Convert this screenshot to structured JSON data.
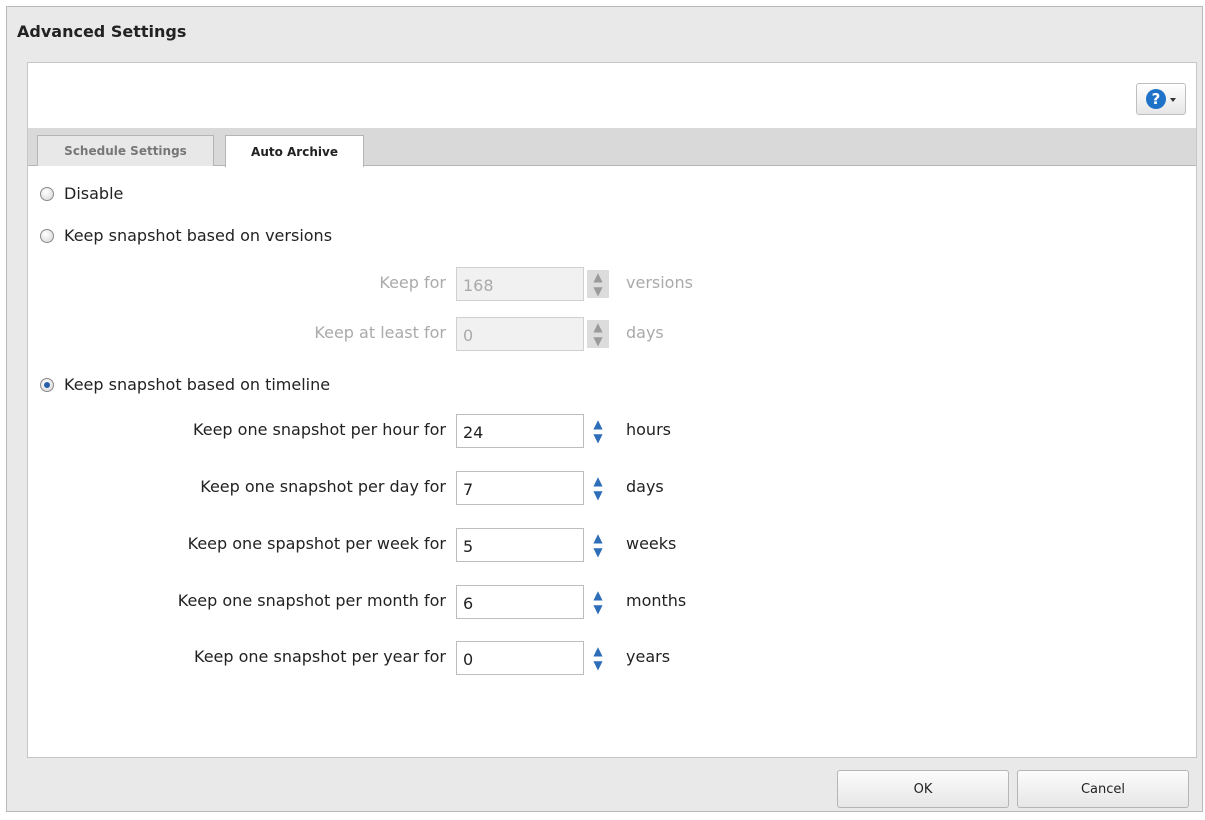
{
  "dialog": {
    "title": "Advanced Settings"
  },
  "help": {
    "icon": "help-icon",
    "glyph": "?"
  },
  "tabs": [
    {
      "label": "Schedule Settings",
      "active": false
    },
    {
      "label": "Auto Archive",
      "active": true
    }
  ],
  "options": {
    "disable": {
      "label": "Disable",
      "checked": false
    },
    "versions": {
      "label": "Keep snapshot based on versions",
      "checked": false,
      "fields": [
        {
          "label": "Keep for",
          "value": "168",
          "unit": "versions"
        },
        {
          "label": "Keep at least for",
          "value": "0",
          "unit": "days"
        }
      ]
    },
    "timeline": {
      "label": "Keep snapshot based on timeline",
      "checked": true,
      "fields": [
        {
          "label": "Keep one snapshot per hour for",
          "value": "24",
          "unit": "hours"
        },
        {
          "label": "Keep one snapshot per day for",
          "value": "7",
          "unit": "days"
        },
        {
          "label": "Keep one spapshot per week for",
          "value": "5",
          "unit": "weeks"
        },
        {
          "label": "Keep one snapshot per month for",
          "value": "6",
          "unit": "months"
        },
        {
          "label": "Keep one snapshot per year for",
          "value": "0",
          "unit": "years"
        }
      ]
    }
  },
  "footer": {
    "ok_label": "OK",
    "cancel_label": "Cancel"
  }
}
